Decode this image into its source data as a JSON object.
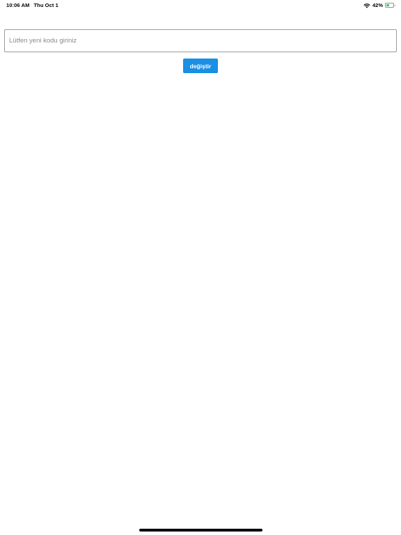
{
  "status_bar": {
    "time": "10:06 AM",
    "date": "Thu Oct 1",
    "battery_percent": "42%",
    "battery_level": 0.42,
    "wifi_icon": "wifi-icon",
    "battery_icon": "battery-icon"
  },
  "form": {
    "code_input": {
      "value": "",
      "placeholder": "Lütfen yeni kodu giriniz"
    },
    "change_button_label": "değiştir"
  },
  "colors": {
    "accent": "#1a8fe3",
    "battery_fill": "#34c759",
    "background": "#ffffff"
  }
}
